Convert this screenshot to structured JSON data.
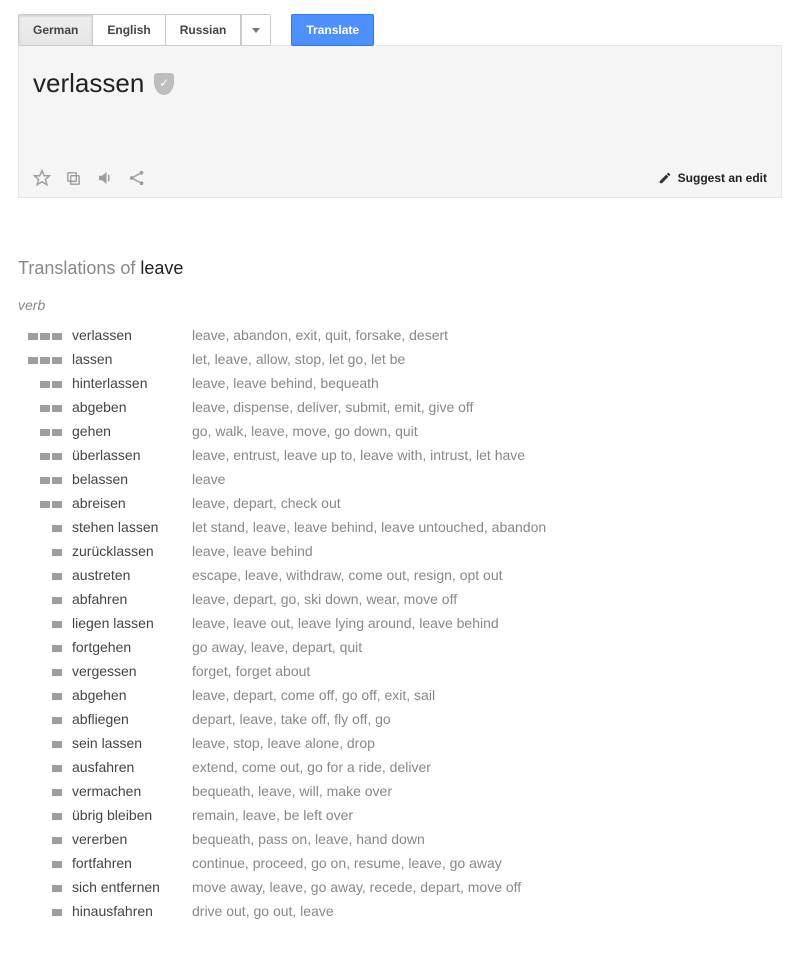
{
  "tabs": {
    "items": [
      "German",
      "English",
      "Russian"
    ],
    "active_index": 0
  },
  "translate_button": "Translate",
  "result": {
    "word": "verlassen",
    "suggest_edit": "Suggest an edit"
  },
  "section": {
    "prefix": "Translations of",
    "word": "leave",
    "pos": "verb"
  },
  "translations": [
    {
      "freq": 3,
      "term": "verlassen",
      "meanings": "leave, abandon, exit, quit, forsake, desert"
    },
    {
      "freq": 3,
      "term": "lassen",
      "meanings": "let, leave, allow, stop, let go, let be"
    },
    {
      "freq": 2,
      "term": "hinterlassen",
      "meanings": "leave, leave behind, bequeath"
    },
    {
      "freq": 2,
      "term": "abgeben",
      "meanings": "leave, dispense, deliver, submit, emit, give off"
    },
    {
      "freq": 2,
      "term": "gehen",
      "meanings": "go, walk, leave, move, go down, quit"
    },
    {
      "freq": 2,
      "term": "überlassen",
      "meanings": "leave, entrust, leave up to, leave with, intrust, let have"
    },
    {
      "freq": 2,
      "term": "belassen",
      "meanings": "leave"
    },
    {
      "freq": 2,
      "term": "abreisen",
      "meanings": "leave, depart, check out"
    },
    {
      "freq": 1,
      "term": "stehen lassen",
      "meanings": "let stand, leave, leave behind, leave untouched, abandon"
    },
    {
      "freq": 1,
      "term": "zurücklassen",
      "meanings": "leave, leave behind"
    },
    {
      "freq": 1,
      "term": "austreten",
      "meanings": "escape, leave, withdraw, come out, resign, opt out"
    },
    {
      "freq": 1,
      "term": "abfahren",
      "meanings": "leave, depart, go, ski down, wear, move off"
    },
    {
      "freq": 1,
      "term": "liegen lassen",
      "meanings": "leave, leave out, leave lying around, leave behind"
    },
    {
      "freq": 1,
      "term": "fortgehen",
      "meanings": "go away, leave, depart, quit"
    },
    {
      "freq": 1,
      "term": "vergessen",
      "meanings": "forget, forget about"
    },
    {
      "freq": 1,
      "term": "abgehen",
      "meanings": "leave, depart, come off, go off, exit, sail"
    },
    {
      "freq": 1,
      "term": "abfliegen",
      "meanings": "depart, leave, take off, fly off, go"
    },
    {
      "freq": 1,
      "term": "sein lassen",
      "meanings": "leave, stop, leave alone, drop"
    },
    {
      "freq": 1,
      "term": "ausfahren",
      "meanings": "extend, come out, go for a ride, deliver"
    },
    {
      "freq": 1,
      "term": "vermachen",
      "meanings": "bequeath, leave, will, make over"
    },
    {
      "freq": 1,
      "term": "übrig bleiben",
      "meanings": "remain, leave, be left over"
    },
    {
      "freq": 1,
      "term": "vererben",
      "meanings": "bequeath, pass on, leave, hand down"
    },
    {
      "freq": 1,
      "term": "fortfahren",
      "meanings": "continue, proceed, go on, resume, leave, go away"
    },
    {
      "freq": 1,
      "term": "sich entfernen",
      "meanings": "move away, leave, go away, recede, depart, move off"
    },
    {
      "freq": 1,
      "term": "hinausfahren",
      "meanings": "drive out, go out, leave"
    }
  ]
}
